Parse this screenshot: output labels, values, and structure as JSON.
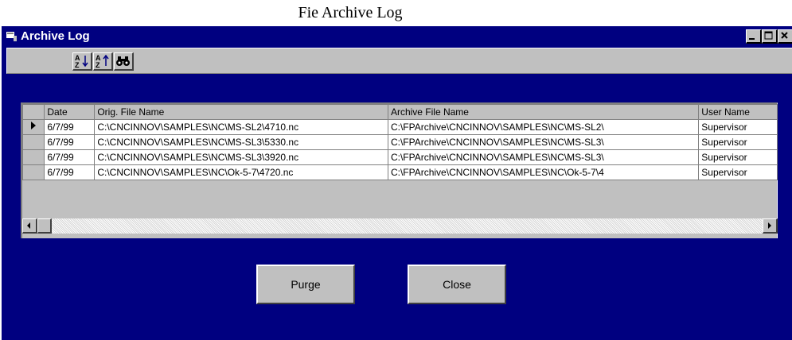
{
  "caption": "Fie Archive Log",
  "window": {
    "title": "Archive Log"
  },
  "toolbar": [
    {
      "icon": "sort-ascending-icon"
    },
    {
      "icon": "sort-descending-icon"
    },
    {
      "icon": "binoculars-find-icon"
    }
  ],
  "grid": {
    "columns": [
      "Date",
      "Orig. File Name",
      "Archive File Name",
      "User Name"
    ],
    "rows": [
      [
        "6/7/99",
        "C:\\CNCINNOV\\SAMPLES\\NC\\MS-SL2\\4710.nc",
        "C:\\FPArchive\\CNCINNOV\\SAMPLES\\NC\\MS-SL2\\",
        "Supervisor"
      ],
      [
        "6/7/99",
        "C:\\CNCINNOV\\SAMPLES\\NC\\MS-SL3\\5330.nc",
        "C:\\FPArchive\\CNCINNOV\\SAMPLES\\NC\\MS-SL3\\",
        "Supervisor"
      ],
      [
        "6/7/99",
        "C:\\CNCINNOV\\SAMPLES\\NC\\MS-SL3\\3920.nc",
        "C:\\FPArchive\\CNCINNOV\\SAMPLES\\NC\\MS-SL3\\",
        "Supervisor"
      ],
      [
        "6/7/99",
        "C:\\CNCINNOV\\SAMPLES\\NC\\Ok-5-7\\4720.nc",
        "C:\\FPArchive\\CNCINNOV\\SAMPLES\\NC\\Ok-5-7\\4",
        "Supervisor"
      ]
    ]
  },
  "buttons": {
    "purge": "Purge",
    "close": "Close"
  },
  "colors": {
    "window_bg": "#000080",
    "face": "#c0c0c0"
  }
}
